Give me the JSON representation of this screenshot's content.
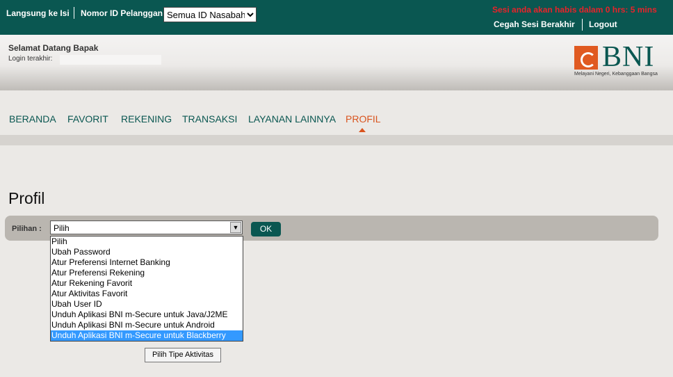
{
  "topbar": {
    "quick_link": "Langsung ke Isi",
    "customer_id_label": "Nomor ID Pelanggan:",
    "customer_id_selected": "Semua ID Nasabah",
    "session_warning": "Sesi anda akan habis dalam 0 hrs: 5 mins",
    "prevent_session_end": "Cegah Sesi Berakhir",
    "logout": "Logout"
  },
  "header": {
    "welcome": "Selamat Datang Bapak",
    "last_login_label": "Login terakhir:",
    "logo_text": "BNI",
    "logo_tagline": "Melayani Negeri, Kebanggaan Bangsa"
  },
  "nav": {
    "items": [
      "BERANDA",
      "FAVORIT",
      "REKENING",
      "TRANSAKSI",
      "LAYANAN LAINNYA",
      "PROFIL"
    ],
    "active": "PROFIL"
  },
  "page": {
    "title": "Profil",
    "filter_label": "Pilihan :",
    "selected_option": "Pilih",
    "ok_label": "OK",
    "options": [
      "Pilih",
      "Ubah Password",
      "Atur Preferensi Internet Banking",
      "Atur Preferensi Rekening",
      "Atur Rekening Favorit",
      "Atur Aktivitas Favorit",
      "Ubah User ID",
      "Unduh Aplikasi BNI m-Secure untuk Java/J2ME",
      "Unduh Aplikasi BNI m-Secure untuk Android",
      "Unduh Aplikasi BNI m-Secure untuk Blackberry"
    ],
    "highlighted_option": "Unduh Aplikasi BNI m-Secure untuk Blackberry",
    "activity_button": "Pilih Tipe Aktivitas"
  },
  "colors": {
    "brand_teal": "#0a5751",
    "brand_orange": "#d9541e",
    "session_red": "#e8232a",
    "highlight_blue": "#3399ff"
  }
}
